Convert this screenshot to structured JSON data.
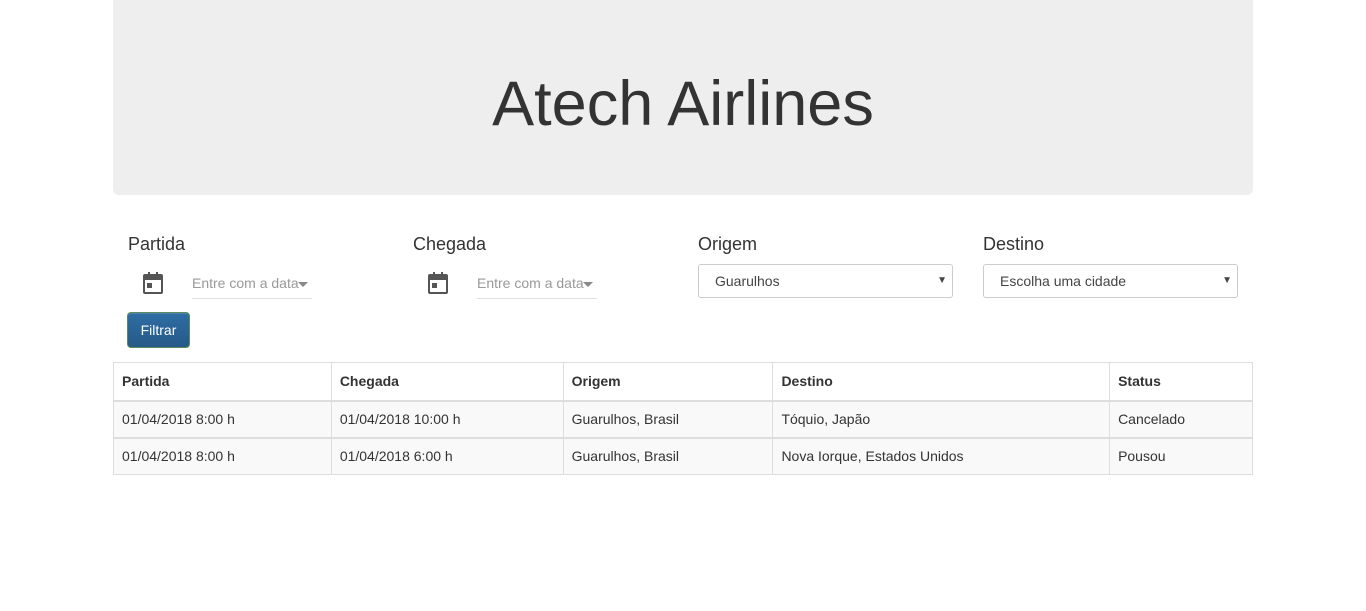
{
  "header": {
    "title": "Atech Airlines"
  },
  "filters": {
    "partida": {
      "label": "Partida",
      "placeholder": "Entre com a data"
    },
    "chegada": {
      "label": "Chegada",
      "placeholder": "Entre com a data"
    },
    "origem": {
      "label": "Origem",
      "selected": "Guarulhos"
    },
    "destino": {
      "label": "Destino",
      "selected": "Escolha uma cidade"
    },
    "submit_label": "Filtrar"
  },
  "table": {
    "columns": [
      "Partida",
      "Chegada",
      "Origem",
      "Destino",
      "Status"
    ],
    "rows": [
      [
        "01/04/2018 8:00 h",
        "01/04/2018 10:00 h",
        "Guarulhos, Brasil",
        "Tóquio, Japão",
        "Cancelado"
      ],
      [
        "01/04/2018 8:00 h",
        "01/04/2018 6:00 h",
        "Guarulhos, Brasil",
        "Nova Iorque, Estados Unidos",
        "Pousou"
      ]
    ]
  },
  "colors": {
    "jumbotron_bg": "#eeeeee",
    "button_bg": "#265a88",
    "stripe_bg": "#f9f9f9"
  },
  "icons": {
    "date": "calendar-icon",
    "dropdown": "caret-down-icon"
  }
}
